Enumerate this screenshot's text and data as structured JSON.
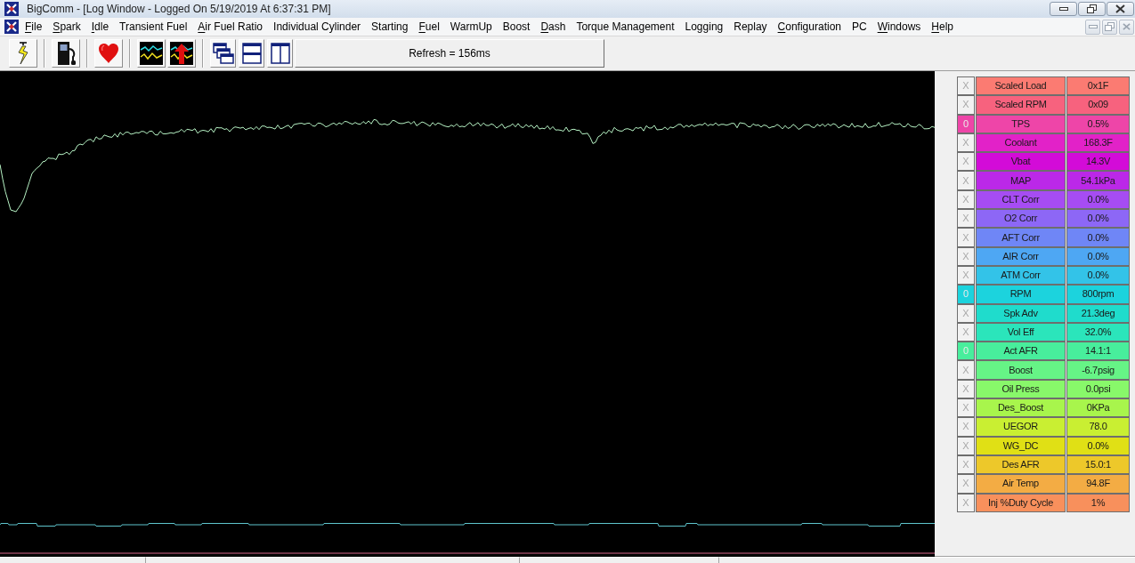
{
  "window": {
    "title": "BigComm - [Log Window - Logged On 5/19/2019 At 6:37:31 PM]"
  },
  "menu": [
    {
      "label": "File",
      "mnemonic": true
    },
    {
      "label": "Spark",
      "mnemonic": true
    },
    {
      "label": "Idle",
      "mnemonic": true
    },
    {
      "label": "Transient Fuel",
      "mnemonic": false
    },
    {
      "label": "Air Fuel Ratio",
      "mnemonic": true
    },
    {
      "label": "Individual Cylinder",
      "mnemonic": false
    },
    {
      "label": "Starting",
      "mnemonic": false
    },
    {
      "label": "Fuel",
      "mnemonic": true
    },
    {
      "label": "WarmUp",
      "mnemonic": false
    },
    {
      "label": "Boost",
      "mnemonic": false
    },
    {
      "label": "Dash",
      "mnemonic": true
    },
    {
      "label": "Torque Management",
      "mnemonic": false
    },
    {
      "label": "Logging",
      "mnemonic": false
    },
    {
      "label": "Replay",
      "mnemonic": false
    },
    {
      "label": "Configuration",
      "mnemonic": true
    },
    {
      "label": "PC",
      "mnemonic": false
    },
    {
      "label": "Windows",
      "mnemonic": true
    },
    {
      "label": "Help",
      "mnemonic": true
    }
  ],
  "toolbar": {
    "refresh": "Refresh = 156ms"
  },
  "channels": [
    {
      "toggle": "X",
      "selected": false,
      "name": "Scaled Load",
      "value": "0x1F",
      "color": "#fb7b72"
    },
    {
      "toggle": "X",
      "selected": false,
      "name": "Scaled RPM",
      "value": "0x09",
      "color": "#f7627e"
    },
    {
      "toggle": "0",
      "selected": true,
      "name": "TPS",
      "value": "0.5%",
      "color": "#ee45a8"
    },
    {
      "toggle": "X",
      "selected": false,
      "name": "Coolant",
      "value": "168.3F",
      "color": "#e222c8"
    },
    {
      "toggle": "X",
      "selected": false,
      "name": "Vbat",
      "value": "14.3V",
      "color": "#d30bd8"
    },
    {
      "toggle": "X",
      "selected": false,
      "name": "MAP",
      "value": "54.1kPa",
      "color": "#bb28e8"
    },
    {
      "toggle": "X",
      "selected": false,
      "name": "CLT Corr",
      "value": "0.0%",
      "color": "#a64cf3"
    },
    {
      "toggle": "X",
      "selected": false,
      "name": "O2 Corr",
      "value": "0.0%",
      "color": "#8d67f6"
    },
    {
      "toggle": "X",
      "selected": false,
      "name": "AFT Corr",
      "value": "0.0%",
      "color": "#6f86f6"
    },
    {
      "toggle": "X",
      "selected": false,
      "name": "AIR Corr",
      "value": "0.0%",
      "color": "#4ea7f3"
    },
    {
      "toggle": "X",
      "selected": false,
      "name": "ATM Corr",
      "value": "0.0%",
      "color": "#33c3e8"
    },
    {
      "toggle": "0",
      "selected": true,
      "name": "RPM",
      "value": "800rpm",
      "color": "#1cd3dd"
    },
    {
      "toggle": "X",
      "selected": false,
      "name": "Spk Adv",
      "value": "21.3deg",
      "color": "#1fdccc"
    },
    {
      "toggle": "X",
      "selected": false,
      "name": "Vol Eff",
      "value": "32.0%",
      "color": "#2be5bb"
    },
    {
      "toggle": "0",
      "selected": true,
      "name": "Act AFR",
      "value": "14.1:1",
      "color": "#48ee9c"
    },
    {
      "toggle": "X",
      "selected": false,
      "name": "Boost",
      "value": "-6.7psig",
      "color": "#66f486"
    },
    {
      "toggle": "X",
      "selected": false,
      "name": "Oil Press",
      "value": "0.0psi",
      "color": "#88f86a"
    },
    {
      "toggle": "X",
      "selected": false,
      "name": "Des_Boost",
      "value": "0KPa",
      "color": "#a8f54c"
    },
    {
      "toggle": "X",
      "selected": false,
      "name": "UEGOR",
      "value": "78.0",
      "color": "#c9ef32"
    },
    {
      "toggle": "X",
      "selected": false,
      "name": "WG_DC",
      "value": "0.0%",
      "color": "#e0e015"
    },
    {
      "toggle": "X",
      "selected": false,
      "name": "Des AFR",
      "value": "15.0:1",
      "color": "#edc82a"
    },
    {
      "toggle": "X",
      "selected": false,
      "name": "Air Temp",
      "value": "94.8F",
      "color": "#f3ac44"
    },
    {
      "toggle": "X",
      "selected": false,
      "name": "Inj %Duty Cycle",
      "value": "1%",
      "color": "#f8905c"
    }
  ]
}
